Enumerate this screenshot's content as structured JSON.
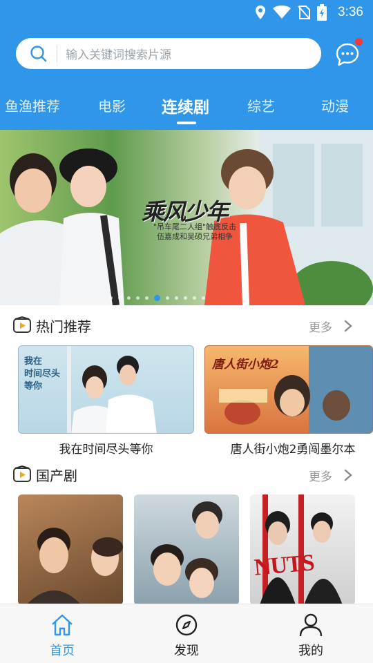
{
  "status_bar": {
    "time": "3:36"
  },
  "search": {
    "placeholder": "输入关键词搜索片源"
  },
  "tabs": [
    {
      "label": "鱼渔推荐"
    },
    {
      "label": "电影"
    },
    {
      "label": "连续剧",
      "active": true
    },
    {
      "label": "综艺"
    },
    {
      "label": "动漫"
    }
  ],
  "banner": {
    "title": "乘风少年",
    "subtitle": "\"吊车尾二人组\"触底反击\n伍嘉成和吴硕兄弟相争",
    "dot_count": 11,
    "active_dot": 5
  },
  "sections": [
    {
      "title": "热门推荐",
      "more": "更多",
      "items": [
        {
          "title": "我在时间尽头等你",
          "poster_text": "我在\n时间尽头\n等你"
        },
        {
          "title": "唐人街小炮2勇闯墨尔本",
          "poster_text": "唐人街小炮2"
        }
      ]
    },
    {
      "title": "国产剧",
      "more": "更多",
      "items": [
        {
          "title": ""
        },
        {
          "title": ""
        },
        {
          "title": "",
          "poster_text": "NUTS"
        }
      ]
    }
  ],
  "bottom_nav": [
    {
      "label": "首页",
      "icon": "home-icon",
      "active": true
    },
    {
      "label": "发现",
      "icon": "compass-icon"
    },
    {
      "label": "我的",
      "icon": "user-icon"
    }
  ],
  "colors": {
    "brand": "#2f96e9",
    "badge": "#f23a3a"
  }
}
